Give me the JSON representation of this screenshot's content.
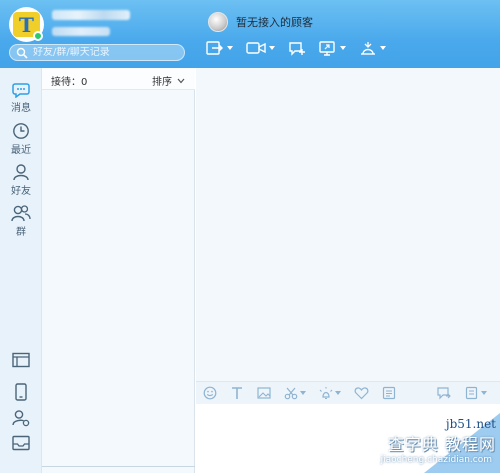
{
  "header": {
    "search_placeholder": "好友/群/聊天记录",
    "visitor_status": "暂无接入的顾客"
  },
  "nav": {
    "items": [
      {
        "icon": "message-icon",
        "label": "消息"
      },
      {
        "icon": "clock-icon",
        "label": "最近"
      },
      {
        "icon": "person-icon",
        "label": "好友"
      },
      {
        "icon": "group-icon",
        "label": "群"
      }
    ],
    "bottom_icons": [
      "window-icon",
      "phone-icon",
      "user-settings-icon",
      "inbox-icon"
    ]
  },
  "list": {
    "reception_label": "接待：0",
    "sort_label": "排序"
  },
  "toolbar": {
    "top_icons": [
      "transfer-icon",
      "video-icon",
      "chat-add-icon",
      "screen-share-icon",
      "remote-assist-icon"
    ],
    "chat_icons": [
      "emoji-icon",
      "font-icon",
      "image-icon",
      "scissors-icon",
      "shake-icon",
      "heart-icon",
      "gallery-icon",
      "chat-history-icon",
      "more-icon"
    ]
  },
  "watermark": {
    "site": "jb51.net",
    "name": "查字典 教程网",
    "url": "jiaocheng.chazidian.com"
  },
  "colors": {
    "header_top": "#6cc0f2",
    "header_bottom": "#43a3e9",
    "nav_bg": "#e8f2fb",
    "chat_bg": "#f3f8fc"
  }
}
